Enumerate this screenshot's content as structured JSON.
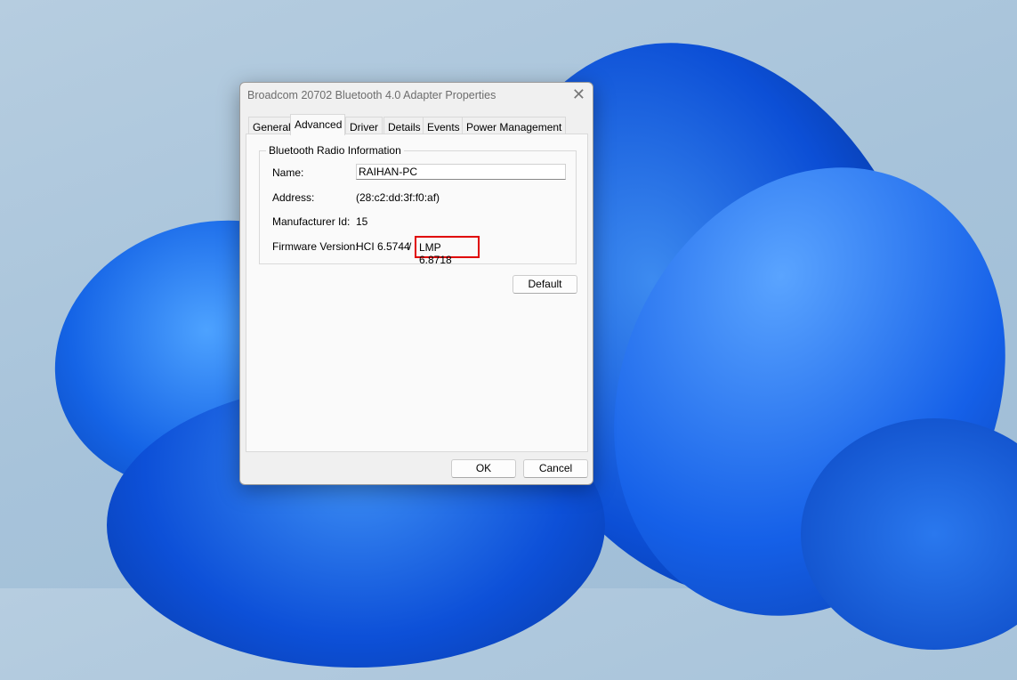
{
  "dialog": {
    "title": "Broadcom 20702 Bluetooth 4.0 Adapter Properties",
    "tabs": [
      {
        "label": "General"
      },
      {
        "label": "Advanced"
      },
      {
        "label": "Driver"
      },
      {
        "label": "Details"
      },
      {
        "label": "Events"
      },
      {
        "label": "Power Management"
      }
    ],
    "active_tab": "Advanced",
    "group_title": "Bluetooth Radio Information",
    "name_label": "Name:",
    "name_value": "RAIHAN-PC",
    "address_label": "Address:",
    "address_value": "(28:c2:dd:3f:f0:af)",
    "manufacturer_label": "Manufacturer Id:",
    "manufacturer_value": "15",
    "firmware_label": "Firmware Version:",
    "firmware_hci": "HCI 6.5744",
    "firmware_sep": "/",
    "firmware_lmp": "LMP 6.8718",
    "default_label": "Default",
    "ok_label": "OK",
    "cancel_label": "Cancel",
    "highlight_color": "#e00000"
  }
}
